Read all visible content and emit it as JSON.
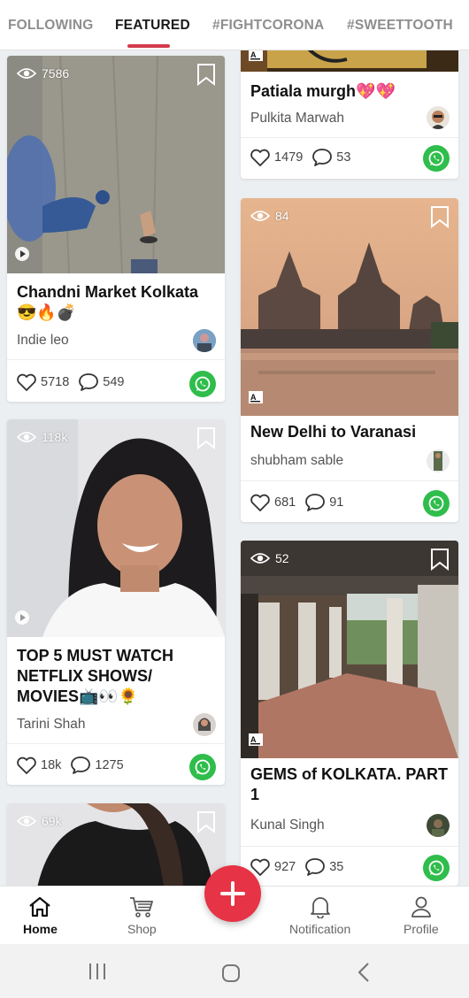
{
  "tabs": [
    {
      "label": "FOLLOWING"
    },
    {
      "label": "FEATURED"
    },
    {
      "label": "#FIGHTCORONA"
    },
    {
      "label": "#SWEETTOOTH"
    }
  ],
  "left_column": [
    {
      "views": "7586",
      "title_line1": "Chandni Market Kolkata",
      "title_line2": "😎🔥💣",
      "author": "Indie leo",
      "likes": "5718",
      "comments": "549"
    },
    {
      "views": "118k",
      "title_line1": "TOP 5 MUST WATCH",
      "title_line2": "NETFLIX SHOWS/",
      "title_line3": "MOVIES📺👀🌻",
      "author": "Tarini Shah",
      "likes": "18k",
      "comments": "1275"
    },
    {
      "views": "69k"
    }
  ],
  "right_column": [
    {
      "title_line1": "Patiala murgh💖💖",
      "author": "Pulkita Marwah",
      "likes": "1479",
      "comments": "53"
    },
    {
      "views": "84",
      "title_line1": "New Delhi to Varanasi",
      "author": "shubham sable",
      "likes": "681",
      "comments": "91"
    },
    {
      "views": "52",
      "title_line1": "GEMS of KOLKATA. PART",
      "title_line2": "1",
      "author": "Kunal Singh",
      "likes": "927",
      "comments": "35"
    }
  ],
  "bottom_nav": {
    "home": "Home",
    "shop": "Shop",
    "notification": "Notification",
    "profile": "Profile"
  },
  "colors": {
    "accent": "#e63345",
    "whatsapp": "#2fbd4b",
    "active_tab": "#1a1a1a",
    "inactive_tab": "#8e8e8e"
  },
  "icons": [
    "eye-icon",
    "bookmark-icon",
    "heart-icon",
    "comment-icon",
    "whatsapp-icon",
    "play-icon",
    "article-icon",
    "home-icon",
    "cart-icon",
    "bell-icon",
    "person-icon",
    "plus-icon"
  ]
}
